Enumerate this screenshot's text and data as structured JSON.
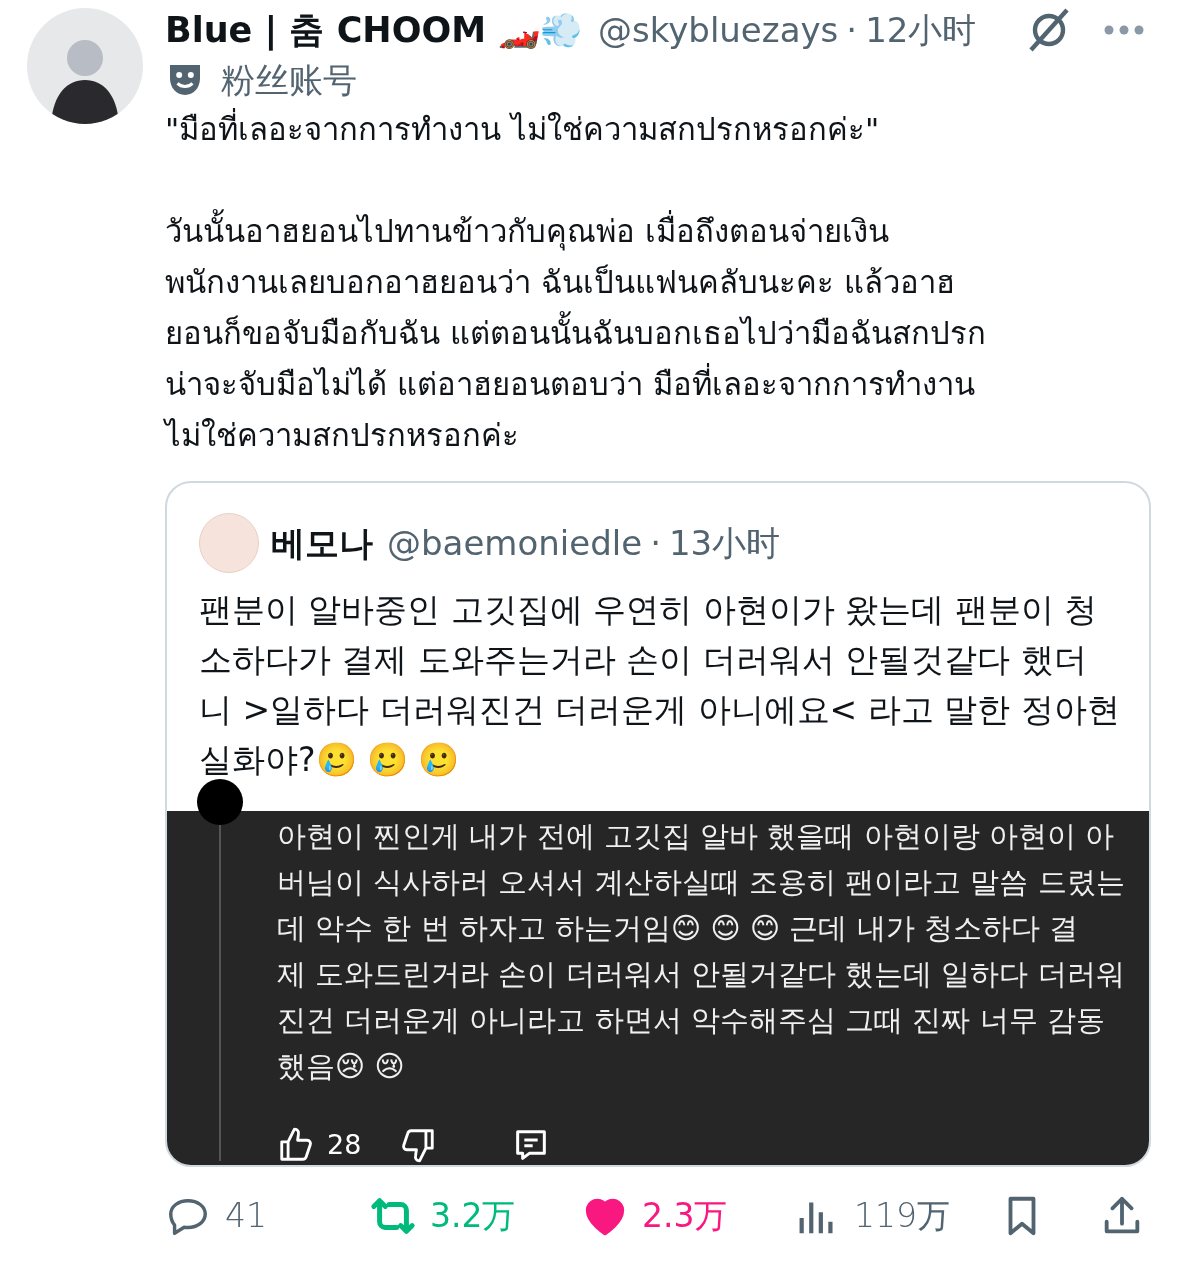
{
  "author": {
    "name": "Blue | 춤 CHOOM",
    "name_emoji": "🏎️💨",
    "handle": "@skybluezays",
    "separator": "·",
    "time": "12小时",
    "label": "粉丝账号"
  },
  "tweet": {
    "paragraphs": [
      [
        "\"มือที่เลอะจากการทำงาน ไม่ใช่ความสกปรกหรอกค่ะ\""
      ],
      [
        "วันนั้นอาฮยอนไปทานข้าวกับคุณพ่อ เมื่อถึงตอนจ่ายเงิน",
        "พนักงานเลยบอกอาฮยอนว่า ฉันเป็นแฟนคลับนะคะ แล้วอาฮ",
        "ยอนก็ขอจับมือกับฉัน แต่ตอนนั้นฉันบอกเธอไปว่ามือฉันสกปรก",
        "น่าจะจับมือไม่ได้ แต่อาฮยอนตอบว่า มือที่เลอะจากการทำงาน",
        "ไม่ใช่ความสกปรกหรอกค่ะ"
      ]
    ]
  },
  "quote": {
    "name": "베모나",
    "handle": "@baemoniedle",
    "separator": "·",
    "time": "13小时",
    "lines": [
      "팬분이 알바중인 고깃집에 우연히 아현이가 왔는데 팬분이 청",
      "소하다가 결제 도와주는거라 손이 더러워서 안될것같다 했더",
      "니 >일하다 더러워진건 더러운게 아니에요< 라고 말한 정아현",
      "실화야?🥲 🥲 🥲"
    ],
    "comment": {
      "lines": [
        "아현이 찐인게 내가 전에 고깃집 알바 했을때 아현이랑 아현이 아",
        "버님이 식사하러 오셔서 계산하실때 조용히 팬이라고 말씀 드렸는",
        "데 악수 한 번 하자고 하는거임😊 😊 😊  근데 내가 청소하다 결",
        "제 도와드린거라 손이 더러워서 안될거같다 했는데 일하다 더러워",
        "진건 더러운게 아니라고 하면서 악수해주심 그때 진짜 너무 감동",
        "했음😢 😢"
      ],
      "likes": "28"
    }
  },
  "actions": [
    {
      "kind": "reply",
      "count": "41"
    },
    {
      "kind": "repost",
      "count": "3.2万",
      "active": true
    },
    {
      "kind": "like",
      "count": "2.3万",
      "active": true
    },
    {
      "kind": "views",
      "count": "119万"
    },
    {
      "kind": "bookmark"
    },
    {
      "kind": "share"
    }
  ]
}
